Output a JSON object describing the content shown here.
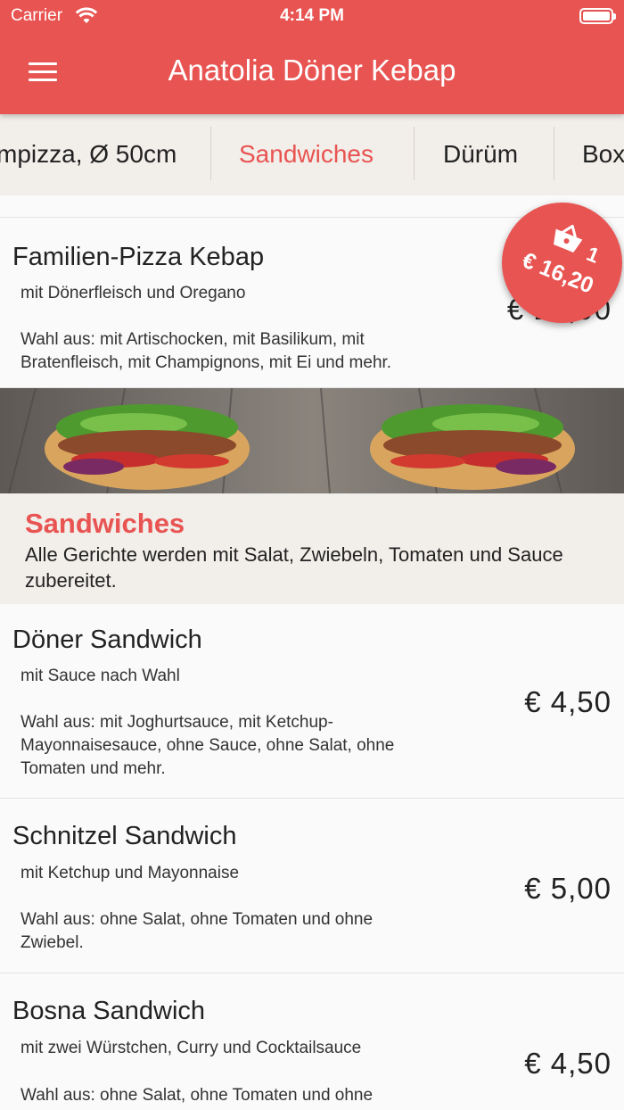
{
  "status": {
    "carrier": "Carrier",
    "time": "4:14 PM"
  },
  "header": {
    "title": "Anatolia Döner Kebap"
  },
  "tabs": [
    {
      "label": "mpizza, Ø 50cm"
    },
    {
      "label": "Sandwiches"
    },
    {
      "label": "Dürüm"
    },
    {
      "label": "Box"
    }
  ],
  "active_tab": "Sandwiches",
  "cart": {
    "count": "1",
    "total": "€ 16,20"
  },
  "items_before": [
    {
      "name": "Familien-Pizza Kebap",
      "description": "mit Dönerfleisch und Oregano",
      "choices": "Wahl aus: mit Artischocken, mit Basilikum, mit Bratenfleisch, mit Champignons, mit Ei und mehr.",
      "price": "€ 17,90"
    }
  ],
  "section": {
    "title": "Sandwiches",
    "description": "Alle Gerichte werden mit Salat, Zwiebeln, Tomaten und Sauce zubereitet."
  },
  "items": [
    {
      "name": "Döner Sandwich",
      "description": "mit Sauce nach Wahl",
      "choices": "Wahl aus: mit Joghurtsauce, mit Ketchup-Mayonnaisesauce, ohne Sauce, ohne Salat, ohne Tomaten und mehr.",
      "price": "€ 4,50"
    },
    {
      "name": "Schnitzel Sandwich",
      "description": "mit Ketchup und Mayonnaise",
      "choices": "Wahl aus: ohne Salat, ohne Tomaten und ohne Zwiebel.",
      "price": "€ 5,00"
    },
    {
      "name": "Bosna Sandwich",
      "description": "mit zwei Würstchen, Curry und Cocktailsauce",
      "choices": "Wahl aus: ohne Salat, ohne Tomaten und ohne",
      "price": "€ 4,50"
    }
  ],
  "colors": {
    "accent": "#e85452",
    "tab_bar": "#f2eeea",
    "background": "#fafafa"
  }
}
